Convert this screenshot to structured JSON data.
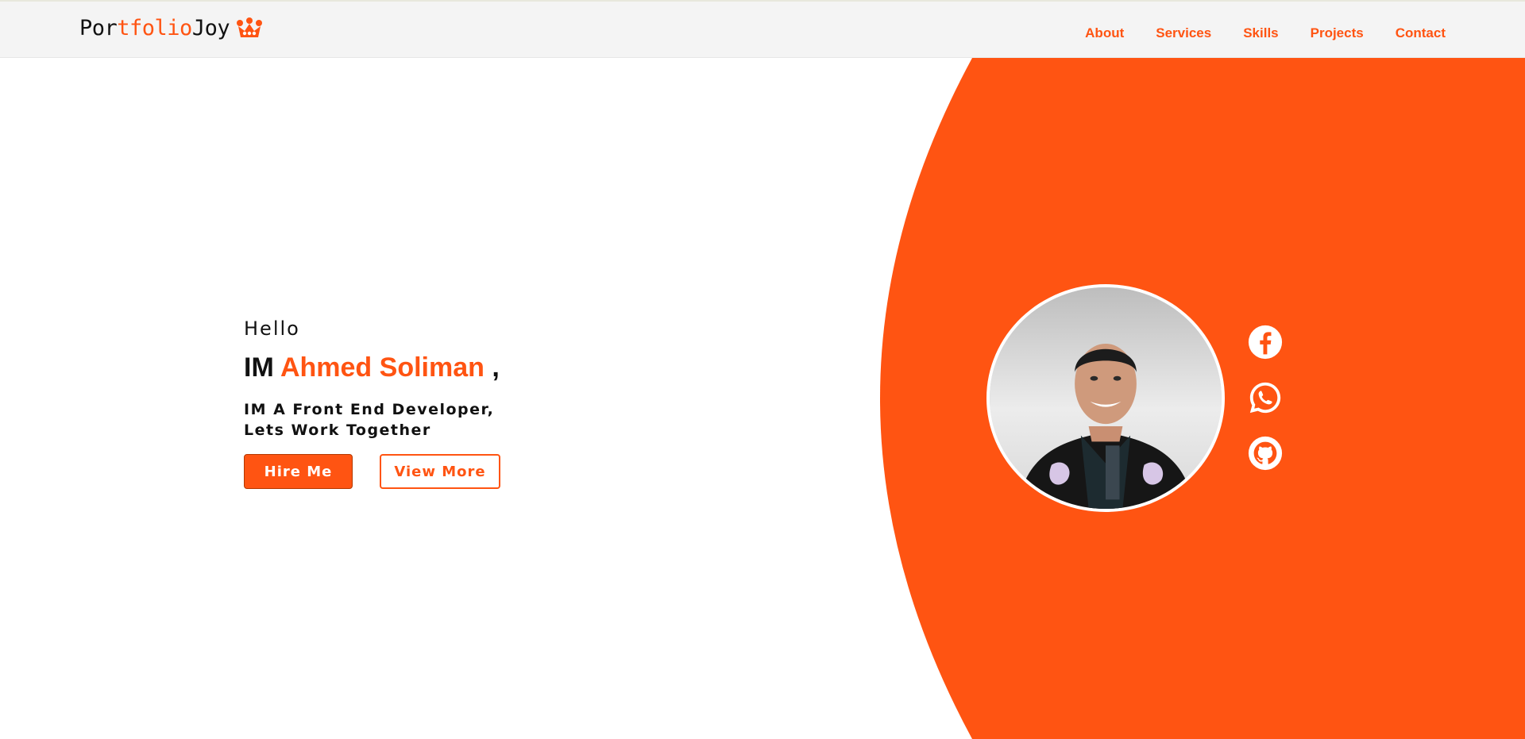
{
  "brand": {
    "logo_part1": "Por",
    "logo_part2": "tfolio",
    "logo_part3": "Joy",
    "logo_icon": "crown-icon",
    "accent_color": "#ff5412"
  },
  "nav": {
    "items": [
      {
        "label": "About"
      },
      {
        "label": "Services"
      },
      {
        "label": "Skills"
      },
      {
        "label": "Projects"
      },
      {
        "label": "Contact"
      }
    ]
  },
  "hero": {
    "greeting": "Hello",
    "im_prefix": "IM",
    "name": "Ahmed Soliman",
    "name_suffix": " ,",
    "tagline_line1": "IM A Front End Developer,",
    "tagline_line2": "Lets Work Together",
    "hire_label": "Hire Me",
    "view_more_label": "View More"
  },
  "socials": [
    {
      "icon": "facebook-icon"
    },
    {
      "icon": "whatsapp-icon"
    },
    {
      "icon": "github-icon"
    }
  ]
}
